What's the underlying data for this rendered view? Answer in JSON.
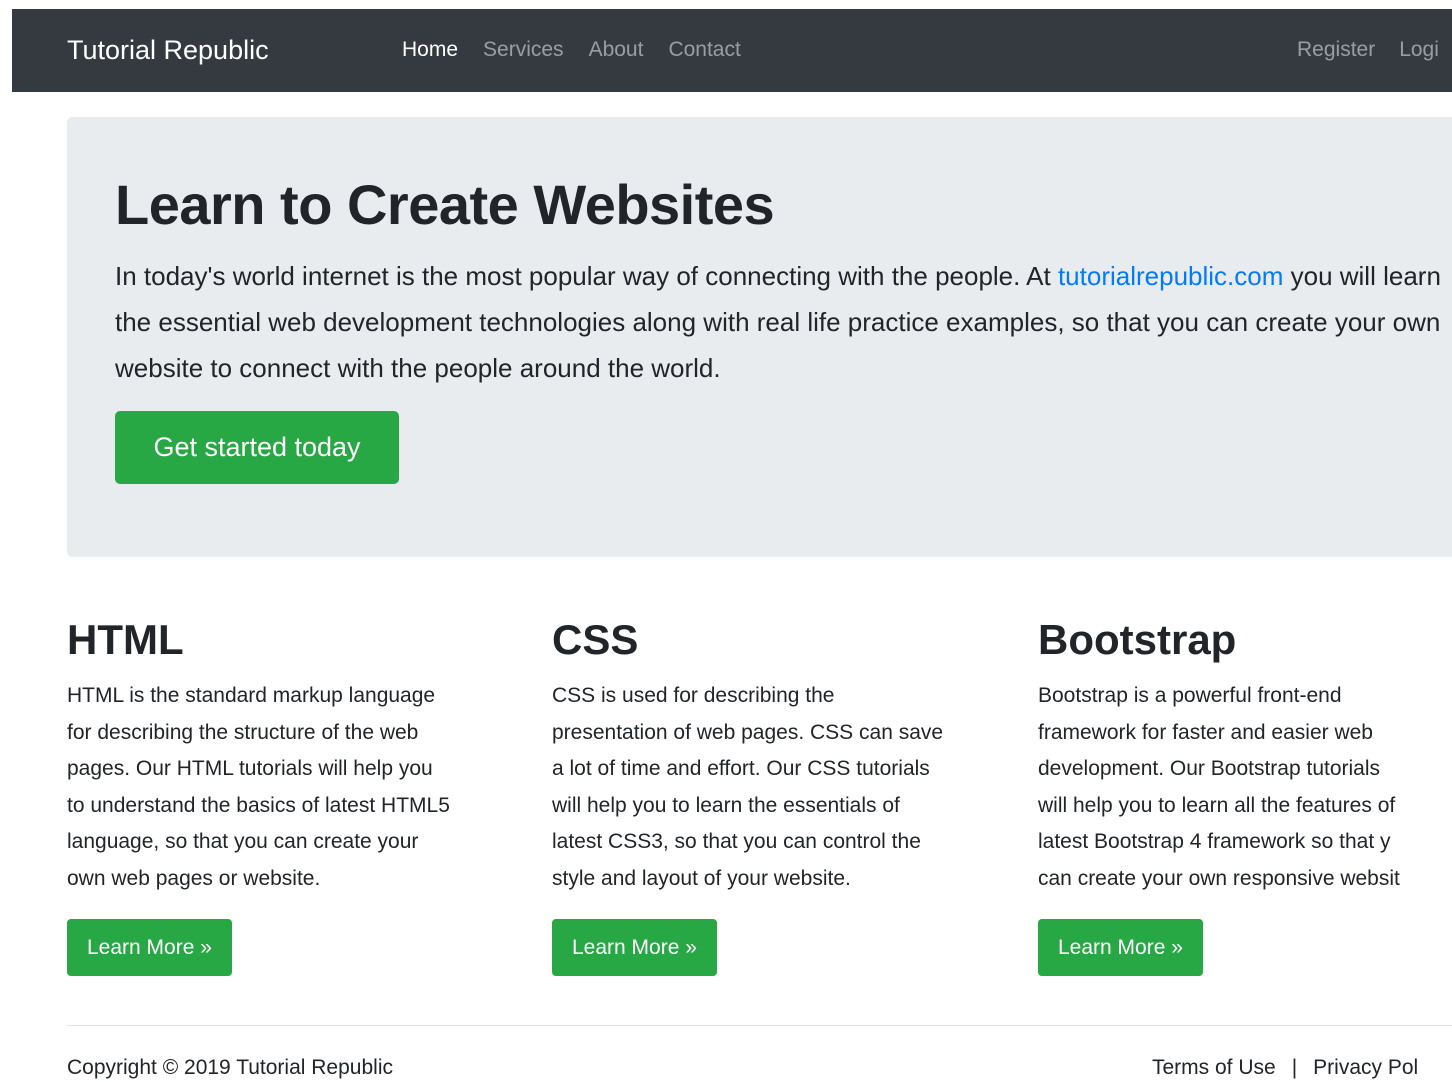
{
  "navbar": {
    "brand": "Tutorial Republic",
    "links": [
      "Home",
      "Services",
      "About",
      "Contact"
    ],
    "right_links": [
      "Register",
      "Logi"
    ]
  },
  "hero": {
    "title": "Learn to Create Websites",
    "lead_before": "In today's world internet is the most popular way of connecting with the people. At ",
    "lead_link": "tutorialrepublic.com",
    "lead_after": " you will learn the essential web development technologies along with real life practice examples, so that you can create your own website to connect with the people around the world.",
    "button": "Get started today"
  },
  "features": [
    {
      "title": "HTML",
      "text": "HTML is the standard markup language\nfor describing the structure of the web\npages. Our HTML tutorials will help you\nto understand the basics of latest HTML5\nlanguage, so that you can create your\nown web pages or website.",
      "button": "Learn More »"
    },
    {
      "title": "CSS",
      "text": "CSS is used for describing the\npresentation of web pages. CSS can save\na lot of time and effort. Our CSS tutorials\nwill help you to learn the essentials of\nlatest CSS3, so that you can control the\nstyle and layout of your website.",
      "button": "Learn More »"
    },
    {
      "title": "Bootstrap",
      "text": "Bootstrap is a powerful front-end\nframework for faster and easier web\ndevelopment. Our Bootstrap tutorials\nwill help you to learn all the features of\nlatest Bootstrap 4 framework so that y\ncan create your own responsive websit",
      "button": "Learn More »"
    }
  ],
  "footer": {
    "copyright": "Copyright © 2019 Tutorial Republic",
    "links": [
      "Terms of Use",
      "Privacy Pol"
    ],
    "separator": "|"
  },
  "colors": {
    "navbar_bg": "#343a40",
    "jumbotron_bg": "#e9ecef",
    "success": "#28a745",
    "link": "#007bff"
  }
}
